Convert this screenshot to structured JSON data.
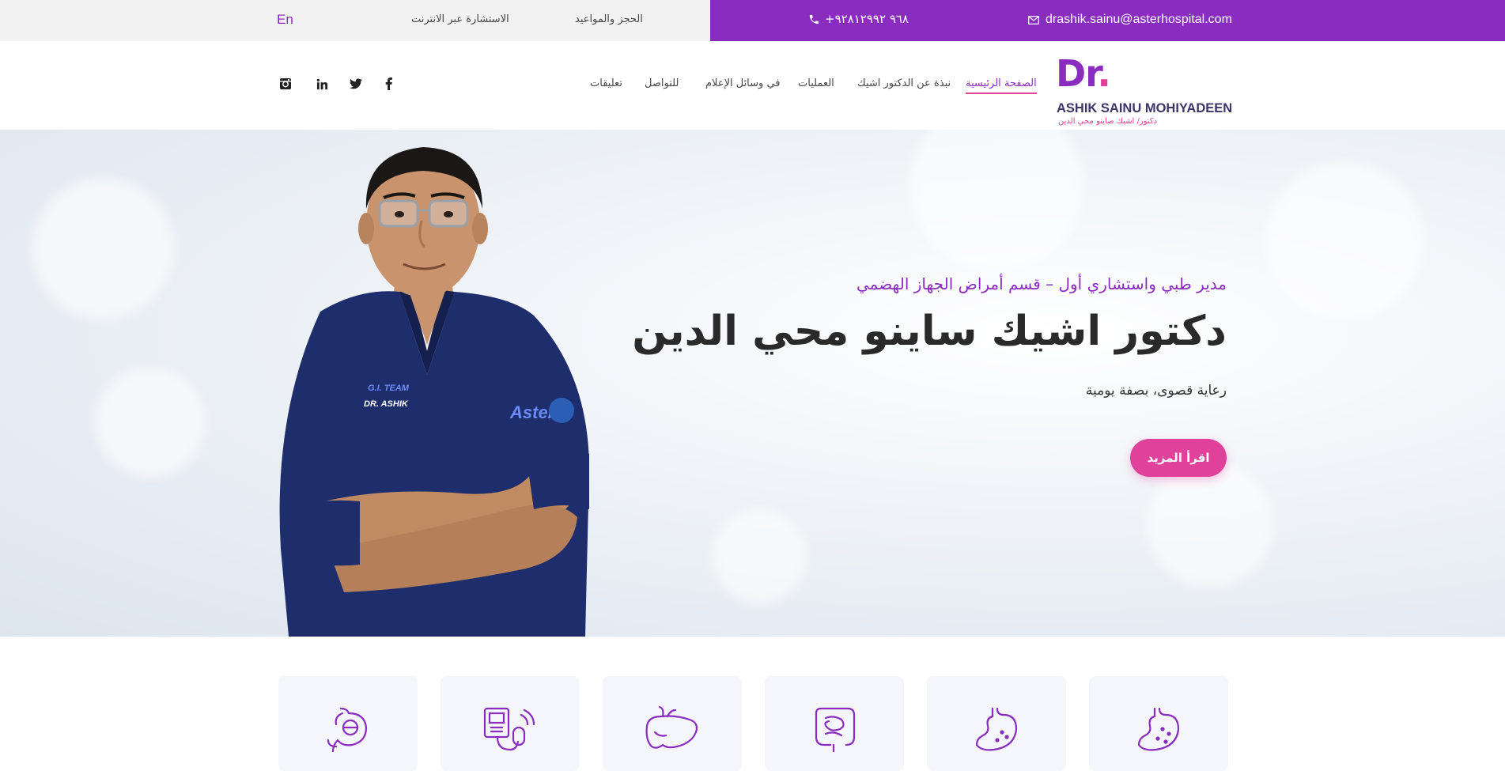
{
  "topbar": {
    "lang_label": "En",
    "online_consult": "الاستشارة عبر الانترنت",
    "booking": "الحجز والمواعيد",
    "phone": "+٩٦٨ ٩٢٨١٢٩٩٢",
    "email": "drashik.sainu@asterhospital.com"
  },
  "logo": {
    "dr": "Dr",
    "dot": ".",
    "name": "ASHIK SAINU MOHIYADEEN",
    "arabic_name": "دكتور/ اشيك صاينو محي الدين"
  },
  "nav": {
    "items": [
      {
        "label": "الصفحة الرئيسية",
        "active": true
      },
      {
        "label": "نبذة عن الدكتور اشيك",
        "active": false
      },
      {
        "label": "العمليات",
        "active": false
      },
      {
        "label": "في وسائل الإعلام",
        "active": false
      },
      {
        "label": "للتواصل",
        "active": false
      },
      {
        "label": "تعليقات",
        "active": false
      }
    ]
  },
  "social": [
    "facebook-icon",
    "twitter-icon",
    "linkedin-icon",
    "instagram-icon"
  ],
  "hero": {
    "subtitle": "مدير طبي واستشاري أول – قسم أمراض الجهاز الهضمي",
    "title": "دكتور اشيك ساينو محي الدين",
    "tagline": "رعاية قصوى، بصفة يومية",
    "button_label": "اقرأ المزيد"
  },
  "colors": {
    "purple": "#8a2cbf",
    "pink": "#e0419a",
    "navy": "#3e3468",
    "scrubs": "#1e2d6b"
  },
  "service_icons": [
    "stomach-balloon-icon",
    "capsule-endoscopy-icon",
    "liver-icon",
    "intestine-icon",
    "stomach-icon",
    "stomach-dots-icon"
  ]
}
